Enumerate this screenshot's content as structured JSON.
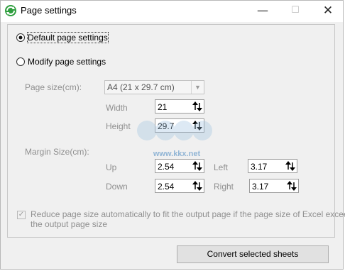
{
  "window": {
    "title": "Page settings"
  },
  "options": {
    "default_label": "Default page settings",
    "modify_label": "Modify page settings"
  },
  "page_size": {
    "label": "Page size(cm):",
    "selected": "A4 (21 x 29.7 cm)",
    "width_label": "Width",
    "width_value": "21",
    "height_label": "Height",
    "height_value": "29.7"
  },
  "margin": {
    "label": "Margin Size(cm):",
    "up_label": "Up",
    "up_value": "2.54",
    "left_label": "Left",
    "left_value": "3.17",
    "down_label": "Down",
    "down_value": "2.54",
    "right_label": "Right",
    "right_value": "3.17"
  },
  "reduce": {
    "label_line1": "Reduce page size automatically to fit the output page if the page size of Excel exceeds",
    "label_line2": "the output page size"
  },
  "button": {
    "label": "Convert selected sheets"
  },
  "watermark": {
    "text": "www.kkx.net"
  }
}
